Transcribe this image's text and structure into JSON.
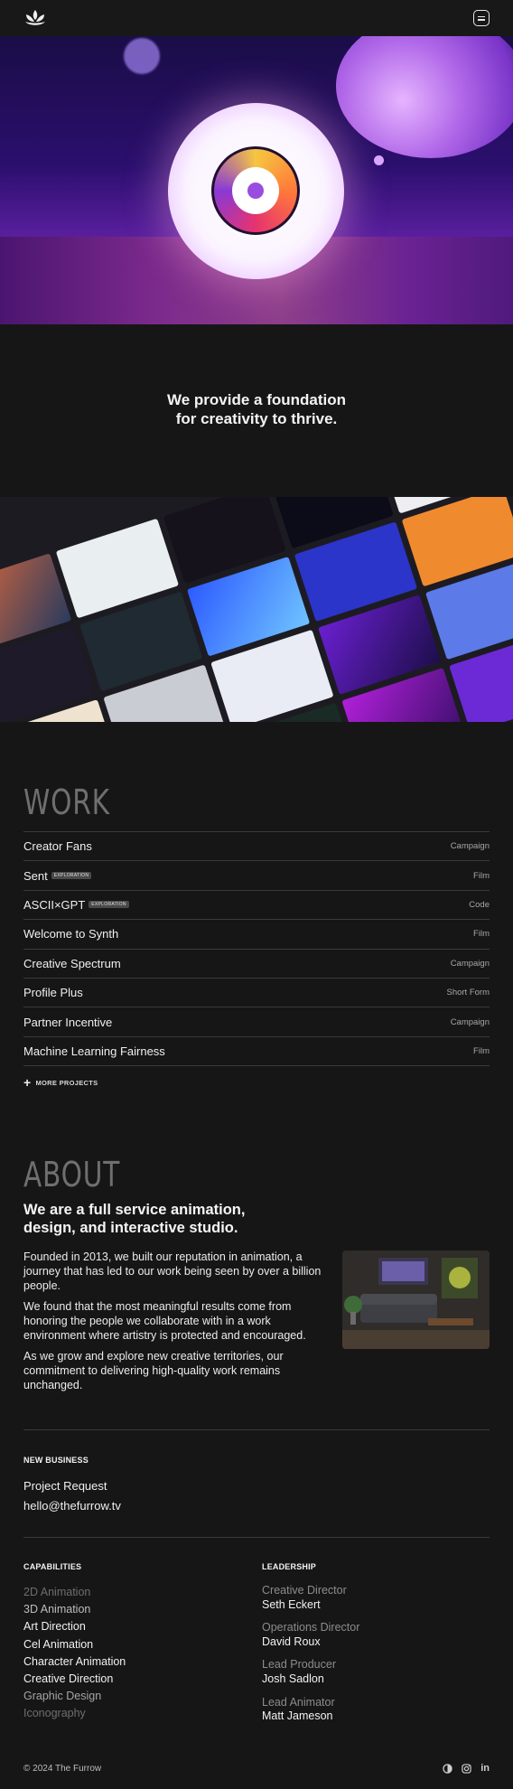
{
  "header": {
    "logo_icon": "lotus-logo-icon",
    "menu_icon": "menu-icon"
  },
  "hero": {
    "tagline_line1": "We provide a foundation",
    "tagline_line2": "for creativity to thrive."
  },
  "work": {
    "title": "WORK",
    "items": [
      {
        "name": "Creator Fans",
        "tag": "",
        "category": "Campaign"
      },
      {
        "name": "Sent",
        "tag": "EXPLORATION",
        "category": "Film"
      },
      {
        "name": "ASCII×GPT",
        "tag": "EXPLORATION",
        "category": "Code"
      },
      {
        "name": "Welcome to Synth",
        "tag": "",
        "category": "Film"
      },
      {
        "name": "Creative Spectrum",
        "tag": "",
        "category": "Campaign"
      },
      {
        "name": "Profile Plus",
        "tag": "",
        "category": "Short Form"
      },
      {
        "name": "Partner Incentive",
        "tag": "",
        "category": "Campaign"
      },
      {
        "name": "Machine Learning Fairness",
        "tag": "",
        "category": "Film"
      }
    ],
    "more_label": "MORE PROJECTS"
  },
  "about": {
    "title": "ABOUT",
    "headline_line1": "We are a full service animation,",
    "headline_line2": "design, and interactive studio.",
    "paragraphs": [
      "Founded in 2013, we built our reputation in animation, a journey that has led to our work being seen by over a billion people.",
      "We found that the most meaningful results come from honoring the people we collaborate with in a work environment where artistry is protected and encouraged.",
      "As we grow and explore new creative territories, our commitment to delivering high-quality work remains unchanged."
    ]
  },
  "new_business": {
    "label": "NEW BUSINESS",
    "project_request": "Project Request",
    "email": "hello@thefurrow.tv"
  },
  "capabilities": {
    "label": "CAPABILITIES",
    "items": [
      {
        "text": "2D Animation",
        "color": "#6e6e6e"
      },
      {
        "text": "3D Animation",
        "color": "#bdbdbd"
      },
      {
        "text": "Art Direction",
        "color": "#f2f2f2"
      },
      {
        "text": "Cel Animation",
        "color": "#f2f2f2"
      },
      {
        "text": "Character Animation",
        "color": "#f2f2f2"
      },
      {
        "text": "Creative Direction",
        "color": "#f2f2f2"
      },
      {
        "text": "Graphic Design",
        "color": "#a5a5a5"
      },
      {
        "text": "Iconography",
        "color": "#6e6e6e"
      }
    ]
  },
  "leadership": {
    "label": "LEADERSHIP",
    "people": [
      {
        "role": "Creative Director",
        "name": "Seth Eckert"
      },
      {
        "role": "Operations Director",
        "name": "David Roux"
      },
      {
        "role": "Lead Producer",
        "name": "Josh Sadlon"
      },
      {
        "role": "Lead Animator",
        "name": "Matt Jameson"
      }
    ]
  },
  "footer": {
    "copyright": "© 2024 The Furrow",
    "socials": [
      "theme-toggle-icon",
      "instagram-icon",
      "linkedin-icon"
    ],
    "linkedin_text": "in"
  }
}
